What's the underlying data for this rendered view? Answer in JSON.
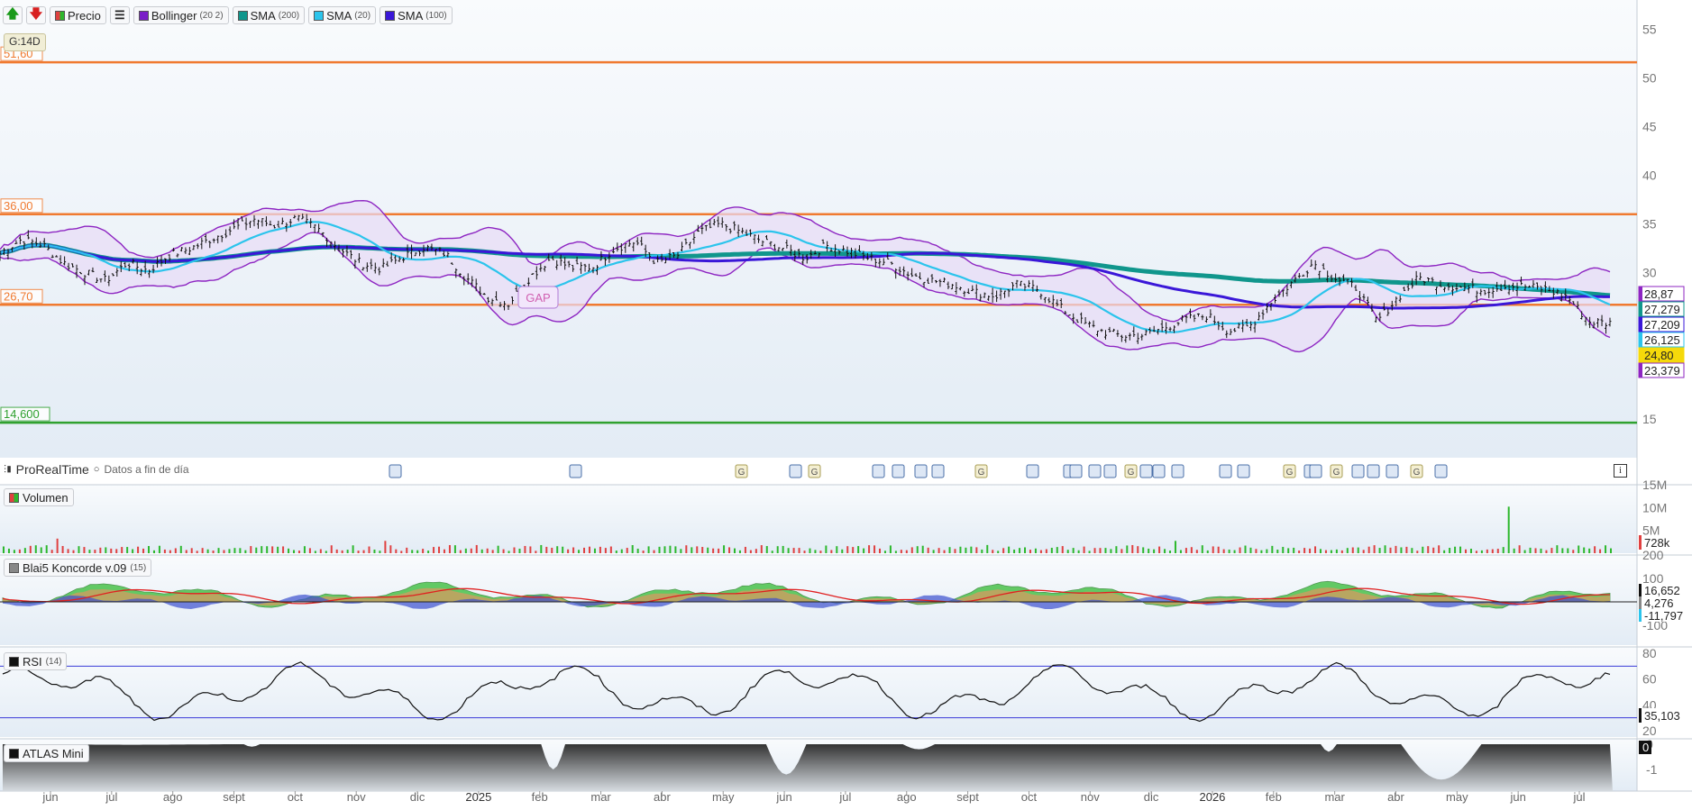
{
  "toolbar": {
    "up_arrow": "🡅",
    "down_arrow": "🡇",
    "price_label": "Precio",
    "list_icon": "list-icon",
    "indicators": [
      {
        "name": "Bollinger",
        "params": "(20 2)",
        "color": "#7a1ec8"
      },
      {
        "name": "SMA",
        "params": "(200)",
        "color": "#10968c"
      },
      {
        "name": "SMA",
        "params": "(20)",
        "color": "#2bc4ec"
      },
      {
        "name": "SMA",
        "params": "(100)",
        "color": "#3a17d8"
      }
    ]
  },
  "period_badge": "G:14D",
  "footer": {
    "brand": "ProRealTime",
    "eod_label": "Datos a fin de día",
    "info": "i"
  },
  "colors": {
    "resistance": "#f07a30",
    "support": "#2fa12f",
    "bollinger": "#8d25c2",
    "bollinger_fill": "#e8dcf7",
    "sma200": "#10968c",
    "sma20": "#2bc4ec",
    "sma100": "#3a17d8",
    "price": "#111111",
    "volume_up": "#2db82d",
    "volume_down": "#e04040",
    "koncorde_green": "#33bb33",
    "koncorde_brown": "#c8a060",
    "koncorde_blue": "#3a4fcf",
    "koncorde_red": "#e02020",
    "atlas_fill": "#9aa0a6"
  },
  "chart_data": [
    {
      "type": "line",
      "panel": "price",
      "x_ticks": [
        "jun",
        "jul",
        "ago",
        "sept",
        "oct",
        "nov",
        "dic",
        "2025",
        "feb",
        "mar",
        "abr",
        "may",
        "jun",
        "jul",
        "ago",
        "sept",
        "oct",
        "nov",
        "dic",
        "2026",
        "feb",
        "mar",
        "abr",
        "may",
        "jun",
        "jul"
      ],
      "y_ticks": [
        "55",
        "50",
        "45",
        "40",
        "35",
        "30",
        "25",
        "20",
        "15"
      ],
      "ylim": [
        11,
        58
      ],
      "levels": [
        {
          "label": "51,60",
          "value": 51.6,
          "color": "resistance"
        },
        {
          "label": "36,00",
          "value": 36.0,
          "color": "resistance"
        },
        {
          "label": "26,70",
          "value": 26.7,
          "color": "resistance"
        },
        {
          "label": "14,600",
          "value": 14.6,
          "color": "support"
        }
      ],
      "annotation": "GAP",
      "price_closes": [
        32.0,
        33.4,
        32.9,
        31.0,
        30.0,
        29.2,
        31.0,
        30.2,
        31.8,
        32.5,
        33.5,
        34.5,
        35.5,
        34.8,
        35.6,
        34.5,
        32.5,
        31.0,
        30.4,
        31.6,
        32.6,
        32.0,
        29.5,
        27.5,
        26.8,
        29.5,
        31.5,
        30.5,
        30.6,
        32.5,
        33.2,
        31.0,
        31.8,
        34.2,
        35.0,
        34.2,
        33.2,
        32.5,
        31.5,
        32.8,
        32.2,
        31.5,
        31.0,
        29.8,
        29.2,
        28.8,
        28.0,
        27.6,
        28.8,
        28.3,
        26.5,
        25.0,
        24.0,
        23.5,
        23.6,
        24.4,
        25.2,
        25.6,
        24.0,
        24.5,
        27.0,
        29.0,
        31.0,
        29.5,
        28.5,
        25.0,
        27.5,
        29.5,
        28.8,
        28.5,
        28.2,
        28.6,
        28.6,
        28.3,
        27.5,
        25.0,
        24.8
      ],
      "current_labels": [
        {
          "text": "28,87",
          "color": "bollinger",
          "text_color": "#222222"
        },
        {
          "text": "27,279",
          "color": "sma200",
          "text_color": "#222222"
        },
        {
          "text": "27,209",
          "color": "sma100",
          "text_color": "#222222"
        },
        {
          "text": "26,125",
          "color": "sma20",
          "text_color": "#222222"
        },
        {
          "text": "24,80",
          "color": "#f5d90a",
          "text_color": "#222222"
        },
        {
          "text": "23,379",
          "color": "bollinger",
          "text_color": "#222222"
        }
      ]
    },
    {
      "type": "bar",
      "panel": "volume",
      "title": "Volumen",
      "y_ticks": [
        "15M",
        "10M",
        "5M"
      ],
      "current_label": "728k",
      "spikes": [
        {
          "pos": 0.035,
          "value": 3200000
        },
        {
          "pos": 0.238,
          "value": 2700000
        },
        {
          "pos": 0.73,
          "value": 2700000
        },
        {
          "pos": 0.935,
          "value": 10200000
        }
      ]
    },
    {
      "type": "area",
      "panel": "koncorde",
      "title": "Blai5 Koncorde v.09",
      "params": "(15)",
      "y_ticks": [
        "200",
        "100",
        "-100"
      ],
      "current_labels": [
        "16,652",
        "4,276",
        "-11,797"
      ]
    },
    {
      "type": "line",
      "panel": "rsi",
      "title": "RSI",
      "params": "(14)",
      "y_ticks": [
        "80",
        "60",
        "40",
        "20"
      ],
      "levels": [
        70,
        30
      ],
      "current_label": "35,103"
    },
    {
      "type": "area",
      "panel": "atlas",
      "title": "ATLAS Mini",
      "y_ticks": [
        "0",
        "-1"
      ],
      "current_label": "0"
    }
  ]
}
